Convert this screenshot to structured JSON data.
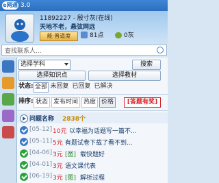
{
  "window": {
    "logo": "e网通",
    "title": "3.0"
  },
  "profile": {
    "user_id": "11892227",
    "user_name": "殷寸灰(在线)",
    "signature": "天地不老，悬弦网远",
    "level_badge": "能·普道度",
    "points": "81点",
    "beans": "0灰"
  },
  "search": {
    "placeholder": "查找联系人..."
  },
  "filters": {
    "subject_select": "选择学科",
    "search_button": "搜索",
    "knowledge_button": "选择知识点",
    "textbook_button": "选择教材",
    "status_label": "状态:",
    "status_options": [
      "全部",
      "未回复",
      "已回复",
      "已解决"
    ],
    "sort_label": "排序:",
    "sort_options": [
      "状态",
      "发布时间",
      "热度",
      "价格"
    ],
    "answer_tag": "[答题有奖]"
  },
  "list": {
    "header_label": "问题名称",
    "header_count": "2838个",
    "items": [
      {
        "date": "[05-12]",
        "reward": "10元",
        "tag": "",
        "title": "以幸福为话题写一篇不..."
      },
      {
        "date": "[05-11]",
        "reward": "5元",
        "tag": "",
        "title": "有题试卷下载了看不到..."
      },
      {
        "date": "[04-06]",
        "reward": "3元",
        "tag": "[图]",
        "title": "载快题好"
      },
      {
        "date": "[04-01]",
        "reward": "3元",
        "tag": "",
        "title": "语文课代表"
      },
      {
        "date": "[06-19]",
        "reward": "3元",
        "tag": "[图]",
        "title": "解析过程"
      }
    ]
  },
  "colors": {
    "accent": "#2d6fbf",
    "reward": "#d2232a",
    "count": "#c98a00"
  }
}
